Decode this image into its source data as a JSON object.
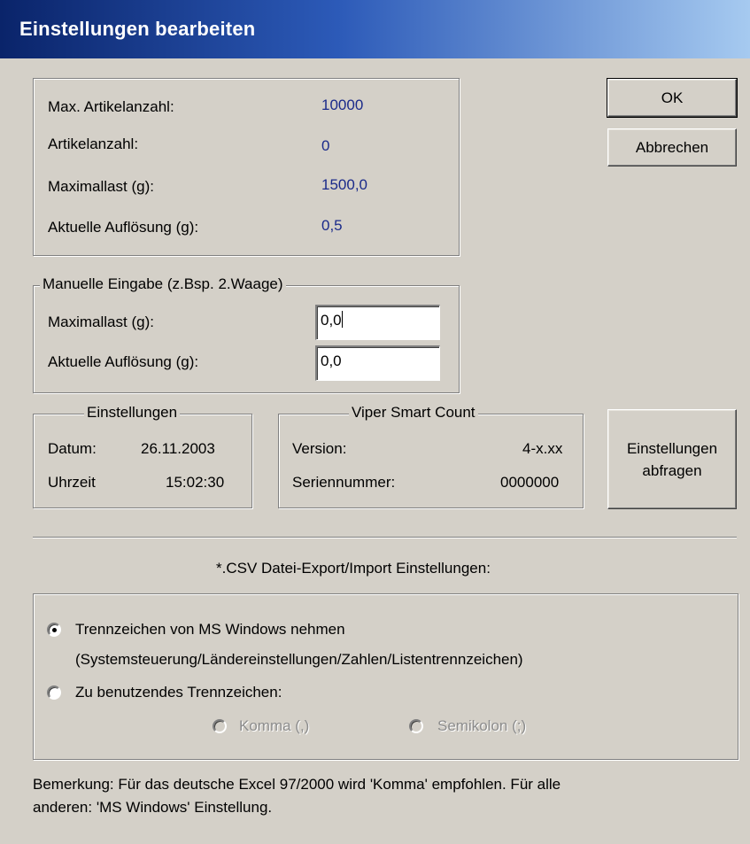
{
  "window": {
    "title": "Einstellungen bearbeiten"
  },
  "buttons": {
    "ok": "OK",
    "cancel": "Abbrechen",
    "query_settings": "Einstellungen\nabfragen"
  },
  "info": {
    "max_articles_label": "Max. Artikelanzahl:",
    "max_articles_value": "10000",
    "articles_label": "Artikelanzahl:",
    "articles_value": "0",
    "max_load_label": "Maximallast (g):",
    "max_load_value": "1500,0",
    "resolution_label": "Aktuelle Auflösung (g):",
    "resolution_value": "0,5"
  },
  "manual": {
    "legend": "Manuelle Eingabe (z.Bsp. 2.Waage)",
    "max_load_label": "Maximallast (g):",
    "max_load_value": "0,0",
    "resolution_label": "Aktuelle Auflösung (g):",
    "resolution_value": "0,0"
  },
  "settings": {
    "legend": "Einstellungen",
    "date_label": "Datum:",
    "date_value": "26.11.2003",
    "time_label": "Uhrzeit",
    "time_value": "15:02:30"
  },
  "device": {
    "legend": "Viper Smart Count",
    "version_label": "Version:",
    "version_value": "4-x.xx",
    "serial_label": "Seriennummer:",
    "serial_value": "0000000"
  },
  "csv": {
    "heading": "*.CSV Datei-Export/Import Einstellungen:",
    "option_windows_label": "Trennzeichen von MS Windows nehmen",
    "option_windows_hint": "(Systemsteuerung/Ländereinstellungen/Zahlen/Listentrennzeichen)",
    "option_custom_label": "Zu benutzendes Trennzeichen:",
    "sub_comma_label": "Komma (,)",
    "sub_semicolon_label": "Semikolon (;)",
    "selected": "windows"
  },
  "note": {
    "line1": "Bemerkung: Für das deutsche Excel 97/2000 wird 'Komma' empfohlen. Für alle",
    "line2": "anderen: 'MS Windows' Einstellung."
  },
  "colors": {
    "dialog_bg": "#d4d0c8",
    "title_start": "#0a246a",
    "title_end": "#a6caf0",
    "value_text": "#1a2a8a"
  }
}
